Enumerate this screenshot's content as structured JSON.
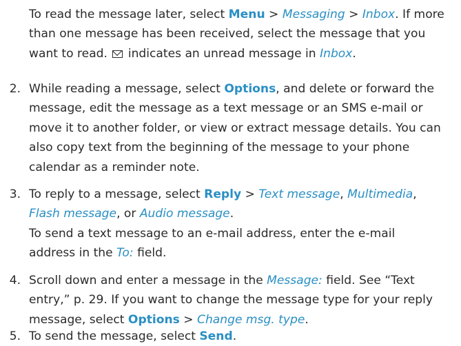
{
  "intro": {
    "line1_prefix": "To read the message later, select ",
    "line1_menu": "Menu",
    "line1_sep1": " > ",
    "line1_messaging": "Messaging",
    "line1_sep2": " > ",
    "line1_inbox": "Inbox",
    "line1_suffix": ". If more",
    "line2": "than one message has been received, select the message that you",
    "line3_prefix": "want to read. ",
    "line3_icon": "envelope-icon",
    "line3_mid": " indicates an unread message in ",
    "line3_inbox": "Inbox",
    "line3_suffix": "."
  },
  "steps": [
    {
      "number": "2.",
      "l1_prefix": "While reading a message, select ",
      "l1_options": "Options",
      "l1_suffix": ", and delete or forward the",
      "l2": "message, edit the message as a text message or an SMS e-mail or",
      "l3": "move it to another folder, or view or extract message details. You can",
      "l4": "also copy text from the beginning of the message to your phone",
      "l5": "calendar as a reminder note."
    },
    {
      "number": "3.",
      "l1_prefix": "To reply to a message, select ",
      "l1_reply": "Reply",
      "l1_sep": " > ",
      "l1_text_message": "Text message",
      "l1_comma1": ", ",
      "l1_multimedia": "Multimedia",
      "l1_comma2": ",",
      "l2_flash": "Flash message",
      "l2_or": ", or ",
      "l2_audio": "Audio message",
      "l2_period": ".",
      "l3": "To send a text message to an e-mail address, enter the e-mail",
      "l4_prefix": "address in the ",
      "l4_to": "To:",
      "l4_suffix": " field."
    },
    {
      "number": "4.",
      "l1_prefix": "Scroll down and enter a message in the ",
      "l1_message": "Message:",
      "l1_suffix": " field. See “Text",
      "l2": "entry,” p. 29. If you want to change the message type for your reply",
      "l3_prefix": "message, select ",
      "l3_options": "Options",
      "l3_sep": " > ",
      "l3_change": "Change msg. type",
      "l3_suffix": "."
    },
    {
      "number": "5.",
      "l1_prefix": "To send the message, select ",
      "l1_send": "Send",
      "l1_suffix": "."
    }
  ],
  "colors": {
    "text": "#2b2b2b",
    "link": "#2a8fc4"
  }
}
